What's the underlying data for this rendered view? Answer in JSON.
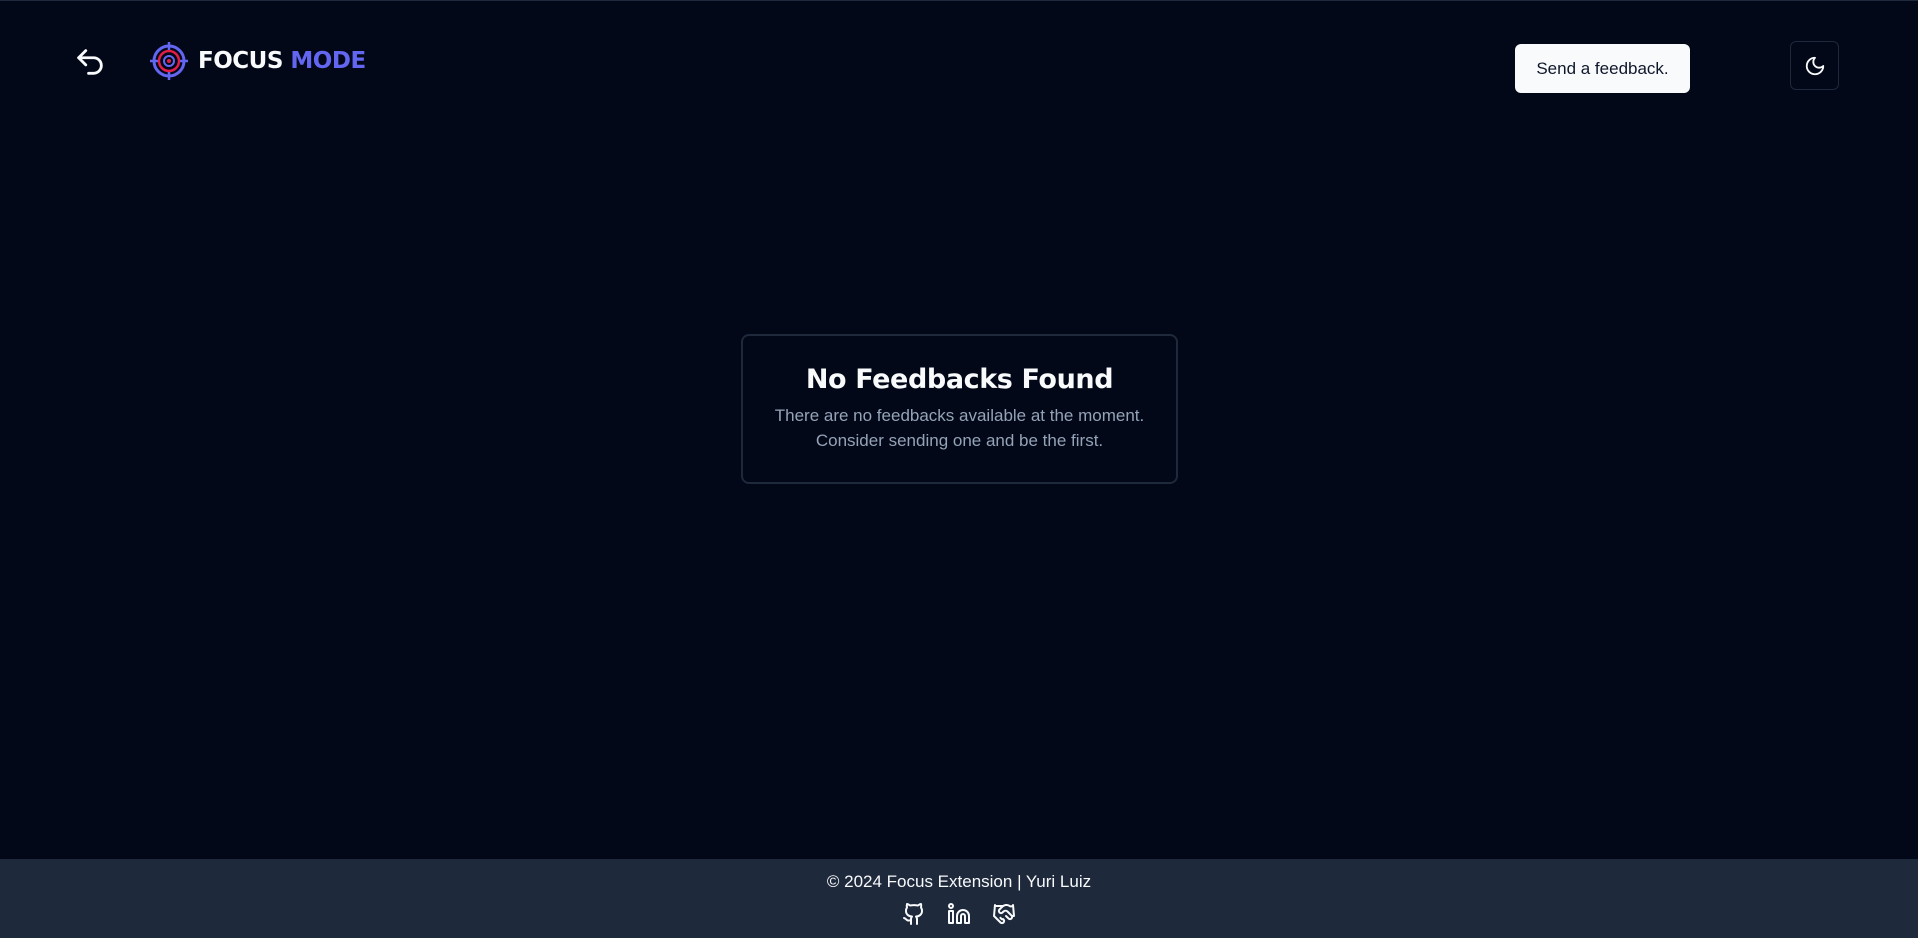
{
  "header": {
    "back_icon": "undo-arrow-icon",
    "logo_icon": "target-icon",
    "logo_word_primary": "FOCUS",
    "logo_word_accent": "MODE",
    "feedback_button_label": "Send a feedback.",
    "theme_icon": "moon-icon"
  },
  "main": {
    "empty_title": "No Feedbacks Found",
    "empty_description": "There are no feedbacks available at the moment. Consider sending one and be the first."
  },
  "footer": {
    "copyright": "© 2024 Focus Extension | Yuri Luiz",
    "links": [
      {
        "icon": "github-icon"
      },
      {
        "icon": "linkedin-icon"
      },
      {
        "icon": "handshake-icon"
      }
    ]
  },
  "colors": {
    "background": "#020817",
    "accent": "#6366f1",
    "footer_background": "#1e293b",
    "muted_text": "#94a3b8"
  }
}
